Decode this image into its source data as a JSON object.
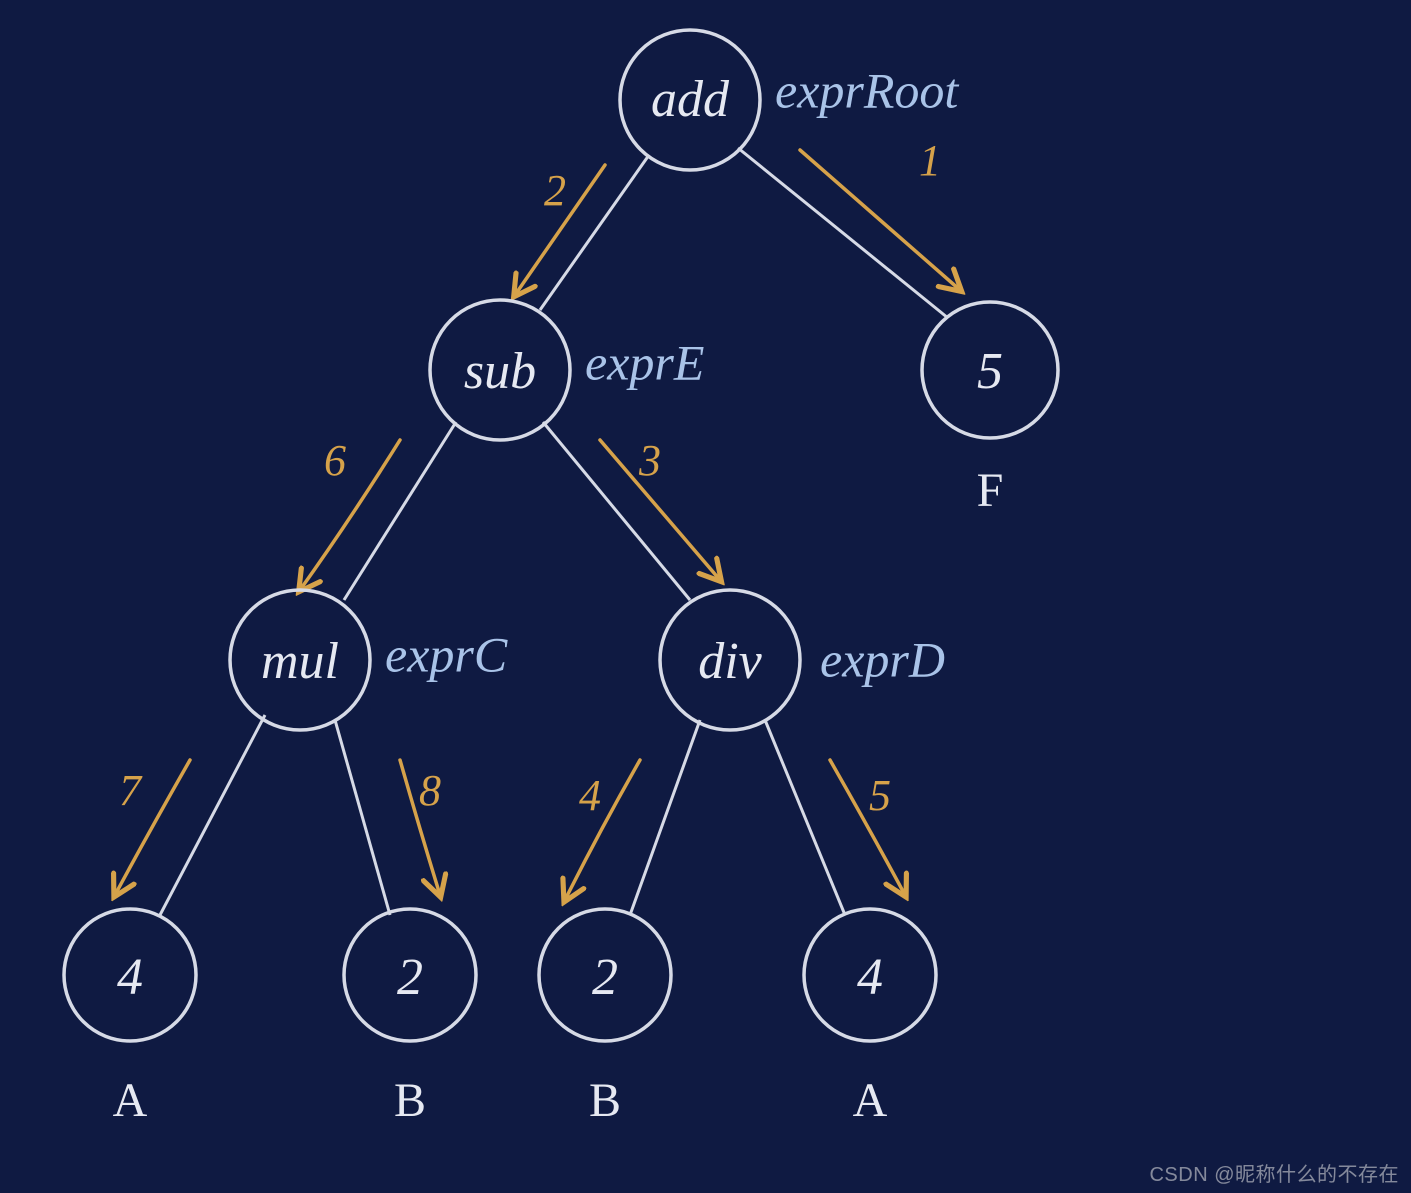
{
  "diagram": {
    "nodes": {
      "root": {
        "value": "add",
        "label": "exprRoot"
      },
      "e": {
        "value": "sub",
        "label": "exprE"
      },
      "f": {
        "value": "5",
        "label": "F"
      },
      "c": {
        "value": "mul",
        "label": "exprC"
      },
      "d": {
        "value": "div",
        "label": "exprD"
      },
      "a1": {
        "value": "4",
        "label": "A"
      },
      "b1": {
        "value": "2",
        "label": "B"
      },
      "b2": {
        "value": "2",
        "label": "B"
      },
      "a2": {
        "value": "4",
        "label": "A"
      }
    },
    "edge_order": {
      "root_f": "1",
      "root_e": "2",
      "e_d": "3",
      "d_b2": "4",
      "d_a2": "5",
      "e_c": "6",
      "c_a1": "7",
      "c_b1": "8"
    }
  },
  "watermark": "CSDN @昵称什么的不存在"
}
